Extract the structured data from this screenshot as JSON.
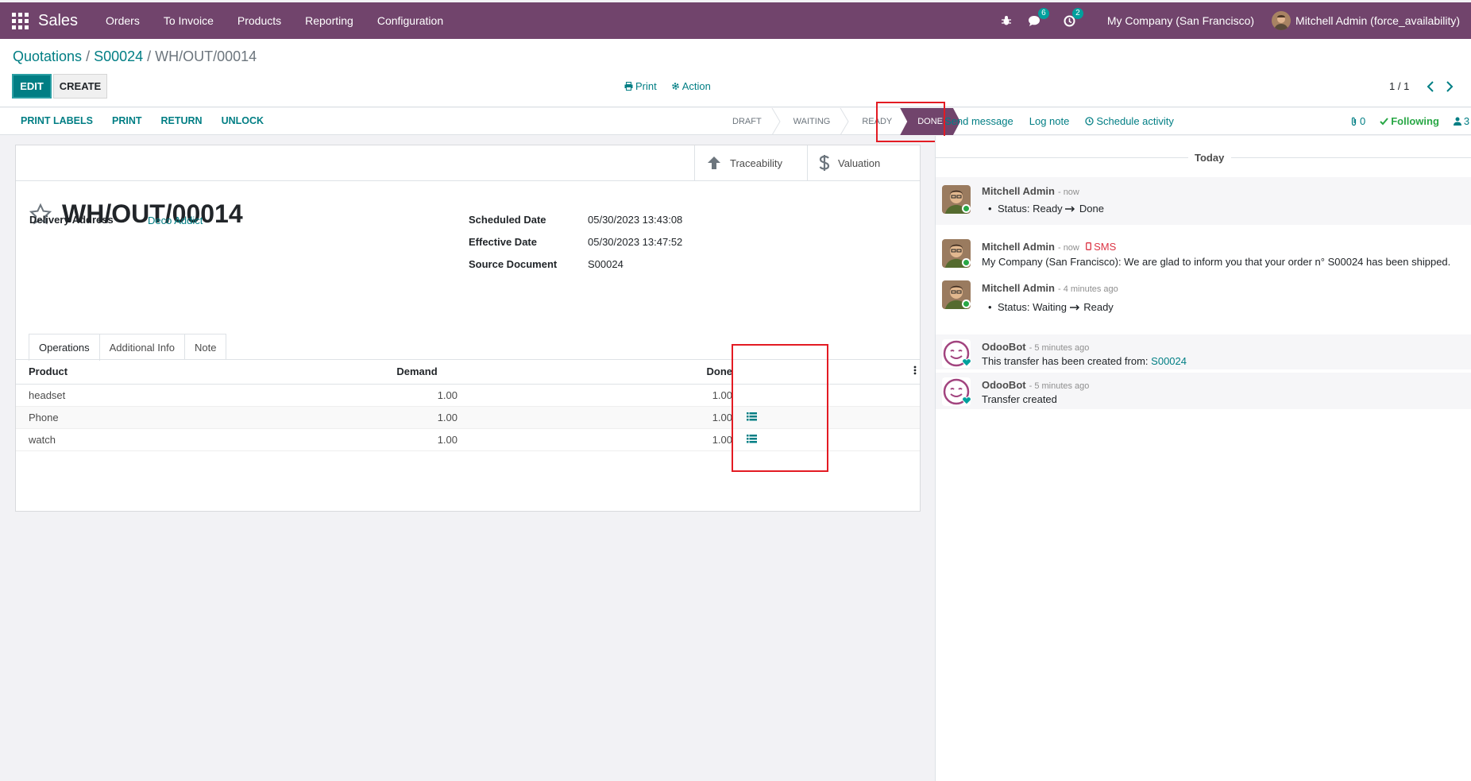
{
  "navbar": {
    "app_name": "Sales",
    "menu": [
      "Orders",
      "To Invoice",
      "Products",
      "Reporting",
      "Configuration"
    ],
    "messages_count": "6",
    "activities_count": "2",
    "company": "My Company (San Francisco)",
    "user": "Mitchell Admin (force_availability)"
  },
  "breadcrumb": {
    "root": "Quotations",
    "order": "S00024",
    "current": "WH/OUT/00014"
  },
  "control": {
    "edit_label": "EDIT",
    "create_label": "CREATE",
    "print_label": "Print",
    "action_label": "Action",
    "pager": "1 / 1"
  },
  "statusbar": {
    "actions": [
      "PRINT LABELS",
      "PRINT",
      "RETURN",
      "UNLOCK"
    ],
    "stages": [
      "DRAFT",
      "WAITING",
      "READY",
      "DONE"
    ],
    "current_stage": "DONE"
  },
  "chatter_buttons": {
    "send_message": "Send message",
    "log_note": "Log note",
    "schedule_activity": "Schedule activity",
    "attachments": "0",
    "following": "Following",
    "followers": "3"
  },
  "form": {
    "buttonbox": [
      "Traceability",
      "Valuation"
    ],
    "title": "WH/OUT/00014",
    "delivery_address_label": "Delivery Address",
    "delivery_address": "Deco Addict",
    "scheduled_date_label": "Scheduled Date",
    "scheduled_date": "05/30/2023 13:43:08",
    "effective_date_label": "Effective Date",
    "effective_date": "05/30/2023 13:47:52",
    "source_document_label": "Source Document",
    "source_document": "S00024",
    "tabs": [
      "Operations",
      "Additional Info",
      "Note"
    ],
    "table": {
      "headers": [
        "Product",
        "Demand",
        "Done"
      ],
      "rows": [
        {
          "product": "headset",
          "demand": "1.00",
          "done": "1.00",
          "detail": false
        },
        {
          "product": "Phone",
          "demand": "1.00",
          "done": "1.00",
          "detail": true
        },
        {
          "product": "watch",
          "demand": "1.00",
          "done": "1.00",
          "detail": true
        }
      ]
    }
  },
  "chatter": {
    "day_label": "Today",
    "messages": [
      {
        "author": "Mitchell Admin",
        "date": "- now",
        "type": "tracking",
        "from": "Ready",
        "to": "Done",
        "label": "Status:"
      },
      {
        "author": "Mitchell Admin",
        "date": "- now",
        "sms": "SMS",
        "type": "text",
        "text": "My Company (San Francisco): We are glad to inform you that your order n° S00024 has been shipped."
      },
      {
        "author": "Mitchell Admin",
        "date": "- 4 minutes ago",
        "type": "tracking",
        "from": "Waiting",
        "to": "Ready",
        "label": "Status:"
      },
      {
        "author": "OdooBot",
        "date": "- 5 minutes ago",
        "type": "link",
        "text": "This transfer has been created from:",
        "link": "S00024"
      },
      {
        "author": "OdooBot",
        "date": "- 5 minutes ago",
        "type": "text",
        "text": "Transfer created"
      }
    ]
  },
  "colors": {
    "brand": "#71446c",
    "primary": "#017e84",
    "highlight": "#e31b23",
    "following": "#28a745"
  }
}
